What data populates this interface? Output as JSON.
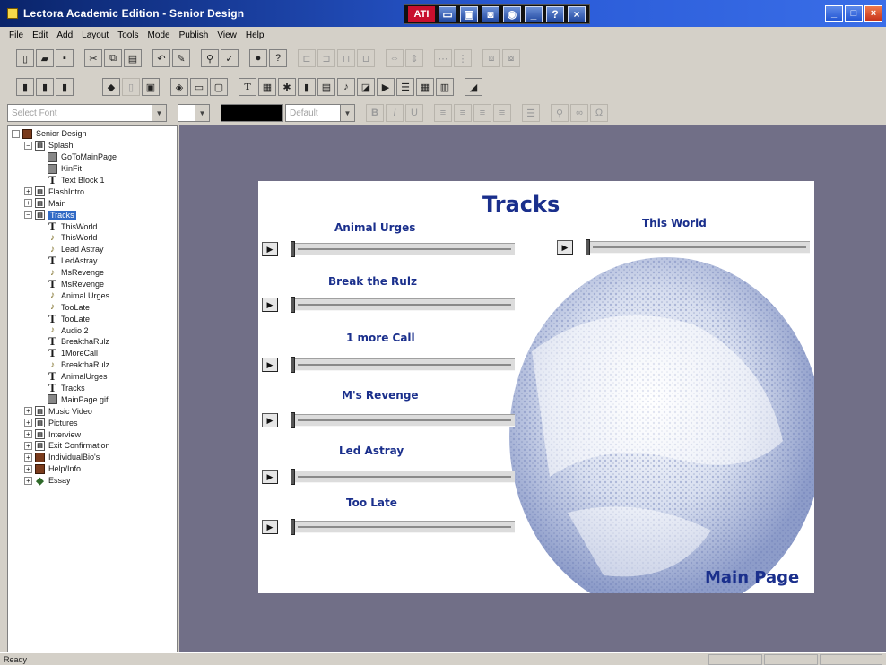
{
  "window": {
    "title": "Lectora Academic Edition - Senior Design",
    "ati_label": "ATI",
    "ati_question": "?",
    "ati_close": "×",
    "controls": {
      "minimize": "_",
      "maximize": "□",
      "close": "×"
    }
  },
  "menu": [
    "File",
    "Edit",
    "Add",
    "Layout",
    "Tools",
    "Mode",
    "Publish",
    "View",
    "Help"
  ],
  "format_toolbar": {
    "font_placeholder": "Select Font",
    "color_label": "Default",
    "bold": "B",
    "italic": "I",
    "underline": "U"
  },
  "tree": [
    {
      "label": "Senior Design",
      "icon": "book-icon",
      "level": 0,
      "exp": "−"
    },
    {
      "label": "Splash",
      "icon": "page-icon",
      "level": 1,
      "exp": "−"
    },
    {
      "label": "GoToMainPage",
      "icon": "action-icon",
      "level": 2,
      "exp": ""
    },
    {
      "label": "KinFit",
      "icon": "action-icon",
      "level": 2,
      "exp": ""
    },
    {
      "label": "Text Block 1",
      "icon": "text-icon",
      "level": 2,
      "exp": ""
    },
    {
      "label": "FlashIntro",
      "icon": "page-icon",
      "level": 1,
      "exp": "+"
    },
    {
      "label": "Main",
      "icon": "page-icon",
      "level": 1,
      "exp": "+"
    },
    {
      "label": "Tracks",
      "icon": "page-icon",
      "level": 1,
      "exp": "−",
      "selected": true
    },
    {
      "label": "ThisWorld",
      "icon": "text-icon",
      "level": 2,
      "exp": ""
    },
    {
      "label": "ThisWorld",
      "icon": "audio-icon",
      "level": 2,
      "exp": ""
    },
    {
      "label": "Lead Astray",
      "icon": "audio-icon",
      "level": 2,
      "exp": ""
    },
    {
      "label": "LedAstray",
      "icon": "text-icon",
      "level": 2,
      "exp": ""
    },
    {
      "label": "MsRevenge",
      "icon": "audio-icon",
      "level": 2,
      "exp": ""
    },
    {
      "label": "MsRevenge",
      "icon": "text-icon",
      "level": 2,
      "exp": ""
    },
    {
      "label": "Animal Urges",
      "icon": "audio-icon",
      "level": 2,
      "exp": ""
    },
    {
      "label": "TooLate",
      "icon": "audio-icon",
      "level": 2,
      "exp": ""
    },
    {
      "label": "TooLate",
      "icon": "text-icon",
      "level": 2,
      "exp": ""
    },
    {
      "label": "Audio 2",
      "icon": "audio-icon",
      "level": 2,
      "exp": ""
    },
    {
      "label": "BreakthaRulz",
      "icon": "text-icon",
      "level": 2,
      "exp": ""
    },
    {
      "label": "1MoreCall",
      "icon": "text-icon",
      "level": 2,
      "exp": ""
    },
    {
      "label": "BreakthaRulz",
      "icon": "audio-icon",
      "level": 2,
      "exp": ""
    },
    {
      "label": "AnimalUrges",
      "icon": "text-icon",
      "level": 2,
      "exp": ""
    },
    {
      "label": "Tracks",
      "icon": "text-icon",
      "level": 2,
      "exp": ""
    },
    {
      "label": "MainPage.gif",
      "icon": "action-icon",
      "level": 2,
      "exp": ""
    },
    {
      "label": "Music Video",
      "icon": "page-icon",
      "level": 1,
      "exp": "+"
    },
    {
      "label": "Pictures",
      "icon": "page-icon",
      "level": 1,
      "exp": "+"
    },
    {
      "label": "Interview",
      "icon": "page-icon",
      "level": 1,
      "exp": "+"
    },
    {
      "label": "Exit Confirmation",
      "icon": "page-icon",
      "level": 1,
      "exp": "+"
    },
    {
      "label": "IndividualBio's",
      "icon": "chapter-icon",
      "level": 1,
      "exp": "+"
    },
    {
      "label": "Help/Info",
      "icon": "chapter-icon",
      "level": 1,
      "exp": "+"
    },
    {
      "label": "Essay",
      "icon": "assess-icon",
      "level": 1,
      "exp": "+"
    }
  ],
  "page": {
    "title": "Tracks",
    "main_link": "Main Page",
    "play_glyph": "▶",
    "tracks": [
      {
        "name": "Animal Urges"
      },
      {
        "name": "Break the Rulz"
      },
      {
        "name": "1 more Call"
      },
      {
        "name": "M's Revenge"
      },
      {
        "name": "Led Astray"
      },
      {
        "name": "Too Late"
      },
      {
        "name": "This World"
      }
    ]
  },
  "status": {
    "text": "Ready"
  },
  "colors": {
    "title_blue": "#1a2f8c",
    "workspace": "#716f87",
    "select": "#316ac5"
  }
}
